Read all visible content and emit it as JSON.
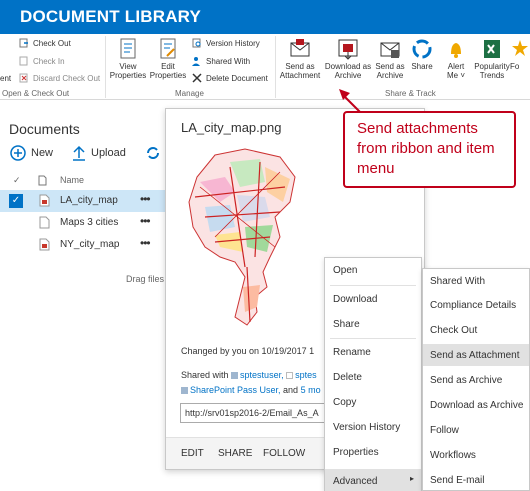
{
  "app": {
    "title": "DOCUMENT LIBRARY"
  },
  "ribbon": {
    "checkout": {
      "group_label": "Open & Check Out",
      "check_out": "Check Out",
      "check_in": "Check In",
      "discard": "Discard Check Out",
      "truncated_left": "ent"
    },
    "manage": {
      "group_label": "Manage",
      "view_properties_1": "View",
      "view_properties_2": "Properties",
      "edit_properties_1": "Edit",
      "edit_properties_2": "Properties",
      "version_history": "Version History",
      "shared_with": "Shared With",
      "delete_document": "Delete Document"
    },
    "share_track": {
      "group_label": "Share & Track",
      "send_attachment_1": "Send as",
      "send_attachment_2": "Attachment",
      "download_archive_1": "Download as",
      "download_archive_2": "Archive",
      "send_archive_1": "Send as",
      "send_archive_2": "Archive",
      "share": "Share",
      "alert_me_1": "Alert",
      "alert_me_2": "Me ˅",
      "popularity_1": "Popularity",
      "popularity_2": "Trends",
      "follow_truncated": "Fo"
    }
  },
  "library": {
    "heading": "Documents",
    "new_label": "New",
    "upload_label": "Upload",
    "name_col": "Name",
    "items": [
      {
        "name": "LA_city_map",
        "selected": true
      },
      {
        "name": "Maps 3 cities",
        "selected": false
      },
      {
        "name": "NY_city_map",
        "selected": false
      }
    ],
    "drag_hint": "Drag files"
  },
  "callout": {
    "title": "LA_city_map.png",
    "changed": "Changed by you on 10/19/2017 1",
    "shared_prefix": "Shared with",
    "user1": "sptestuser,",
    "user2": "sptes",
    "user3": "SharePoint Pass User,",
    "and_text": " and ",
    "more": "5 mo",
    "url": "http://srv01sp2016-2/Email_As_A",
    "footer": {
      "edit": "EDIT",
      "share": "SHARE",
      "follow": "FOLLOW"
    }
  },
  "annotation": {
    "text": "Send attachments from ribbon and item menu"
  },
  "context_menu": {
    "items": [
      "Open",
      "Download",
      "Share",
      "Rename",
      "Delete",
      "Copy",
      "Version History",
      "Properties",
      "Advanced"
    ]
  },
  "advanced_menu": {
    "items": [
      "Shared With",
      "Compliance Details",
      "Check Out",
      "Send as Attachment",
      "Send as Archive",
      "Download as Archive",
      "Follow",
      "Workflows",
      "Send E-mail"
    ],
    "highlighted": "Send as Attachment"
  },
  "colors": {
    "accent": "#0072c6",
    "annotation": "#c0001a",
    "highlight": "#e1e1e1"
  }
}
